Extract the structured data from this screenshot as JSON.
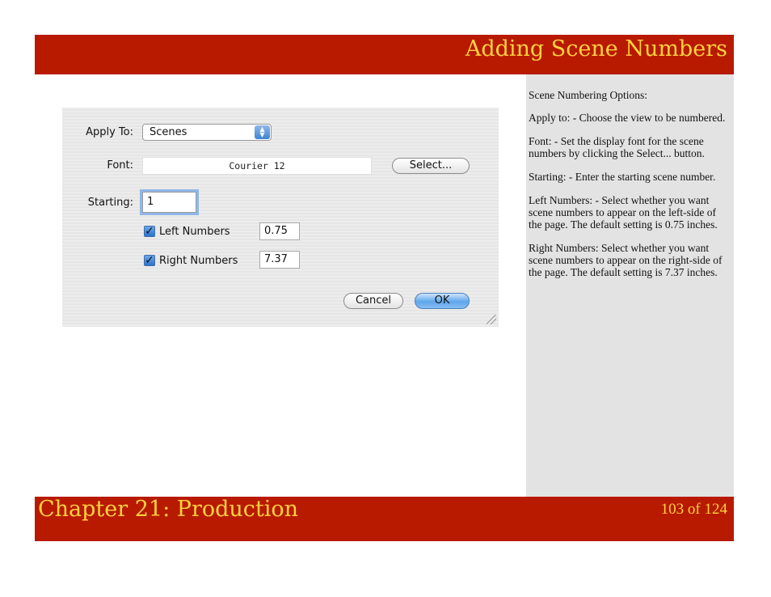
{
  "header": {
    "title": "Adding Scene Numbers"
  },
  "dialog": {
    "apply_to_label": "Apply To:",
    "apply_to_value": "Scenes",
    "font_label": "Font:",
    "font_value": "Courier 12",
    "select_button": "Select...",
    "starting_label": "Starting:",
    "starting_value": "1",
    "left_numbers_label": "Left Numbers",
    "left_numbers_checked": true,
    "left_numbers_value": "0.75",
    "right_numbers_label": "Right Numbers",
    "right_numbers_checked": true,
    "right_numbers_value": "7.37",
    "cancel_button": "Cancel",
    "ok_button": "OK"
  },
  "sidebar": {
    "paragraphs": [
      "Scene Numbering Options:",
      "Apply to:  - Choose the view to be numbered.",
      "Font: - Set the display font for the scene numbers by clicking the Select... button.",
      "Starting: - Enter the starting scene number.",
      "Left Numbers: - Select whether you want scene numbers to appear on the left-side of the page. The default setting is 0.75 inches.",
      "Right Numbers: Select whether you want scene numbers to appear on the right-side of the page. The default setting is 7.37 inches."
    ]
  },
  "footer": {
    "chapter": "Chapter 21: Production",
    "page": "103 of 124"
  },
  "colors": {
    "bar": "#b81a00",
    "title_text": "#ffd23f",
    "panel": "#e3e3e3",
    "accent": "#3d82d6"
  }
}
